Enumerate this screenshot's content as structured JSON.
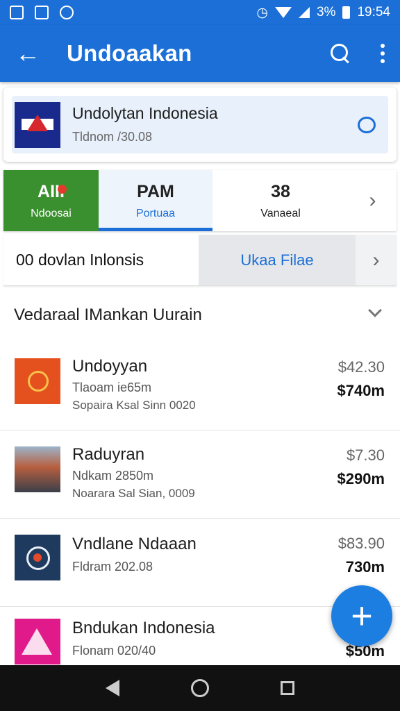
{
  "status_bar": {
    "battery_text": "3%",
    "time": "19:54"
  },
  "app_bar": {
    "title": "Undoaakan"
  },
  "header_card": {
    "title": "Undolytan Indonesia",
    "subtitle": "Tldnom /30.08"
  },
  "tabs": [
    {
      "big": "AIII",
      "small": "Ndoosai"
    },
    {
      "big": "PAM",
      "small": "Portuaa"
    },
    {
      "big": "38",
      "small": "Vanaeal"
    }
  ],
  "filter": {
    "label": "00 dovlan Inlonsis",
    "button": "Ukaa Filae"
  },
  "section": {
    "title": "Vedaraal IMankan Uurain"
  },
  "list_items": [
    {
      "title": "Undoyyan",
      "sub": "Tlaoam ie65m",
      "meta": "Sopaira Ksal Sinn 0020",
      "price_a": "$42.30",
      "price_b": "$740m"
    },
    {
      "title": "Raduyran",
      "sub": "Ndkam 2850m",
      "meta": "Noarara Sal Sian, 0009",
      "price_a": "$7.30",
      "price_b": "$290m"
    },
    {
      "title": "Vndlane Ndaaan",
      "sub": "Fldram 202.08",
      "meta": "",
      "price_a": "$83.90",
      "price_b": "730m"
    },
    {
      "title": "Bndukan Indonesia",
      "sub": "Flonam 020/40",
      "meta": "",
      "price_a": "",
      "price_b": "$50m"
    }
  ],
  "colors": {
    "primary": "#1b6fd6",
    "tab_green": "#3a8f2e"
  }
}
